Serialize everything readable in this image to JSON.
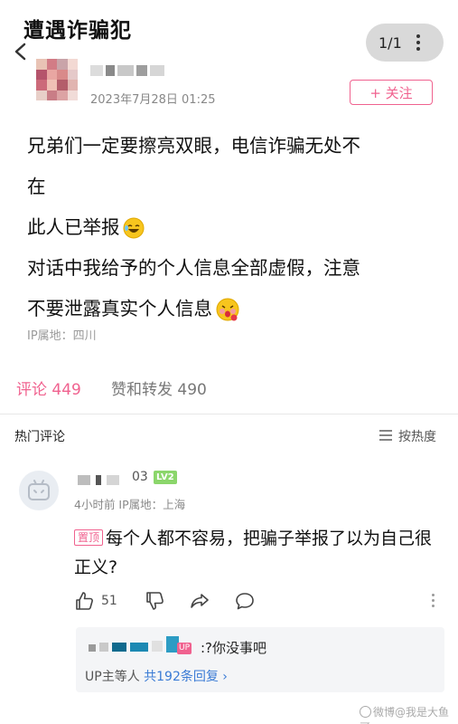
{
  "header": {
    "title": "遭遇诈骗犯",
    "page_counter": "1/1"
  },
  "post": {
    "time": "2023年7月28日 01:25",
    "follow_label": "+ 关注",
    "lines": [
      "兄弟们一定要擦亮双眼，电信诈骗无处不",
      "在",
      "此人已举报",
      "对话中我给予的个人信息全部虚假，注意",
      "不要泄露真实个人信息"
    ],
    "ip_location": "IP属地：四川"
  },
  "tabs": {
    "comments": "评论 449",
    "reposts": "赞和转发 490"
  },
  "comments_section": {
    "heading": "热门评论",
    "sort_label": "按热度"
  },
  "comment": {
    "name_suffix": "03",
    "level": "LV2",
    "meta": "4小时前 IP属地：上海",
    "pinned": "置顶",
    "text": "每个人都不容易，把骗子举报了以为自己很正义?",
    "like_count": "51",
    "reply": {
      "up_badge": "UP",
      "text": ":?你没事吧",
      "summary_prefix": "UP主等人 ",
      "summary_link": "共192条回复 ›"
    }
  },
  "watermark": "微博@我是大鱼哥",
  "icons": {
    "back": "back-arrow-icon",
    "more": "more-dots-icon",
    "sort": "sort-lines-icon",
    "like": "thumbs-up-icon",
    "dislike": "thumbs-down-icon",
    "share": "share-icon",
    "reply": "reply-bubble-icon"
  },
  "colors": {
    "accent": "#f0628f",
    "link": "#3a7bd5",
    "level_badge": "#8bd66b"
  }
}
